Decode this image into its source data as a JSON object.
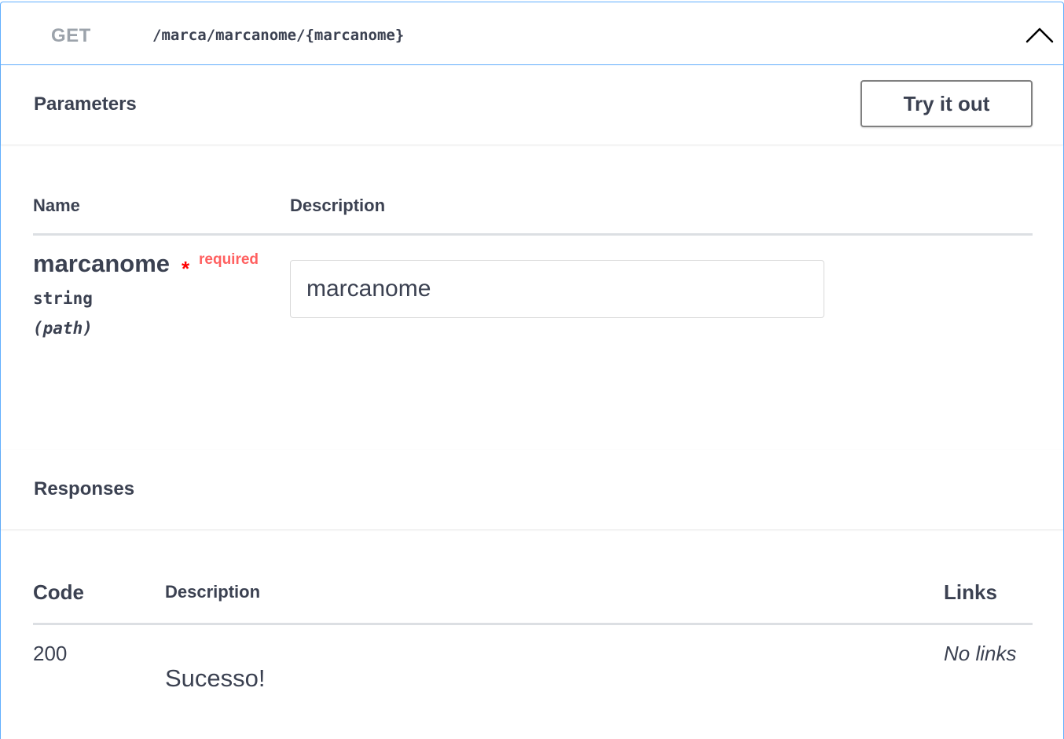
{
  "operation": {
    "method": "GET",
    "path": "/marca/marcanome/{marcanome}",
    "border_color": "#61affe",
    "method_color": "#9ca3ab"
  },
  "parameters": {
    "title": "Parameters",
    "try_button": "Try it out",
    "columns": {
      "name": "Name",
      "description": "Description"
    },
    "items": [
      {
        "name": "marcanome",
        "required_star": "*",
        "required_label": "required",
        "type": "string",
        "in": "(path)",
        "input_placeholder": "marcanome"
      }
    ]
  },
  "responses": {
    "title": "Responses",
    "columns": {
      "code": "Code",
      "description": "Description",
      "links": "Links"
    },
    "rows": [
      {
        "code": "200",
        "description": "Sucesso!",
        "links": "No links"
      }
    ]
  },
  "icons": {
    "collapse": "chevron-up-icon"
  },
  "colors": {
    "required": "#ff0000",
    "required_label": "#ff6060",
    "text": "#3b4151"
  }
}
